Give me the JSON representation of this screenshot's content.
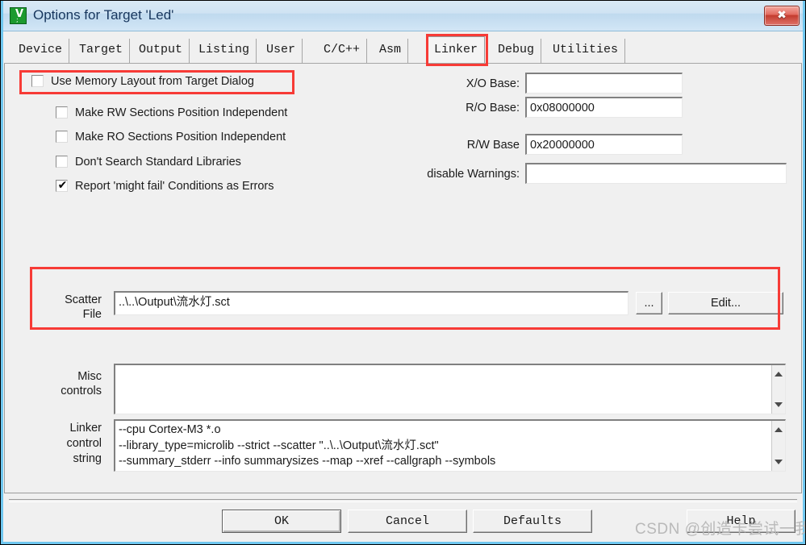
{
  "window": {
    "title": "Options for Target 'Led'",
    "icon_name": "keil-uvision-icon",
    "close_label": "✖",
    "accent_border": "#6fc7ef",
    "titlebar_text_color": "#17365d"
  },
  "tabs": [
    {
      "label": "Device",
      "selected": false
    },
    {
      "label": "Target",
      "selected": false
    },
    {
      "label": "Output",
      "selected": false
    },
    {
      "label": "Listing",
      "selected": false
    },
    {
      "label": "User",
      "selected": false
    },
    {
      "label": "C/C++",
      "selected": false
    },
    {
      "label": "Asm",
      "selected": false
    },
    {
      "label": "Linker",
      "selected": true
    },
    {
      "label": "Debug",
      "selected": false
    },
    {
      "label": "Utilities",
      "selected": false
    }
  ],
  "checkboxes": [
    {
      "label": "Use Memory Layout from Target Dialog",
      "checked": false,
      "tick": ""
    },
    {
      "label": "Make RW Sections Position Independent",
      "checked": false,
      "tick": ""
    },
    {
      "label": "Make RO Sections Position Independent",
      "checked": false,
      "tick": ""
    },
    {
      "label": "Don't Search Standard Libraries",
      "checked": false,
      "tick": ""
    },
    {
      "label": "Report 'might fail' Conditions as Errors",
      "checked": true,
      "tick": "✔"
    }
  ],
  "fields": {
    "xo_base": {
      "label": "X/O Base:",
      "value": "",
      "placeholder": ""
    },
    "ro_base": {
      "label": "R/O Base:",
      "value": "0x08000000",
      "placeholder": ""
    },
    "rw_base": {
      "label": "R/W Base",
      "value": "0x20000000",
      "placeholder": ""
    },
    "disable_warnings": {
      "label": "disable Warnings:",
      "value": "",
      "placeholder": ""
    }
  },
  "scatter": {
    "label_line1": "Scatter",
    "label_line2": "File",
    "value": "..\\..\\Output\\流水灯.sct",
    "placeholder": "",
    "browse_label": "...",
    "edit_label": "Edit..."
  },
  "misc": {
    "label_line1": "Misc",
    "label_line2": "controls",
    "value": ""
  },
  "linker_control": {
    "label_line1": "Linker",
    "label_line2": "control",
    "label_line3": "string",
    "value": "--cpu Cortex-M3 *.o\n--library_type=microlib --strict --scatter \"..\\..\\Output\\流水灯.sct\"\n--summary_stderr --info summarysizes --map --xref --callgraph --symbols"
  },
  "footer": {
    "ok_label": "OK",
    "cancel_label": "Cancel",
    "defaults_label": "Defaults",
    "help_label": "Help"
  },
  "watermark": {
    "text": "CSDN @创造卡尝试一我",
    "color": "#b9b9b9"
  },
  "annotations": {
    "accent_color": "#f73b36",
    "regions": [
      "linker-tab",
      "use-memory-layout-checkbox",
      "scatter-file-section"
    ]
  }
}
